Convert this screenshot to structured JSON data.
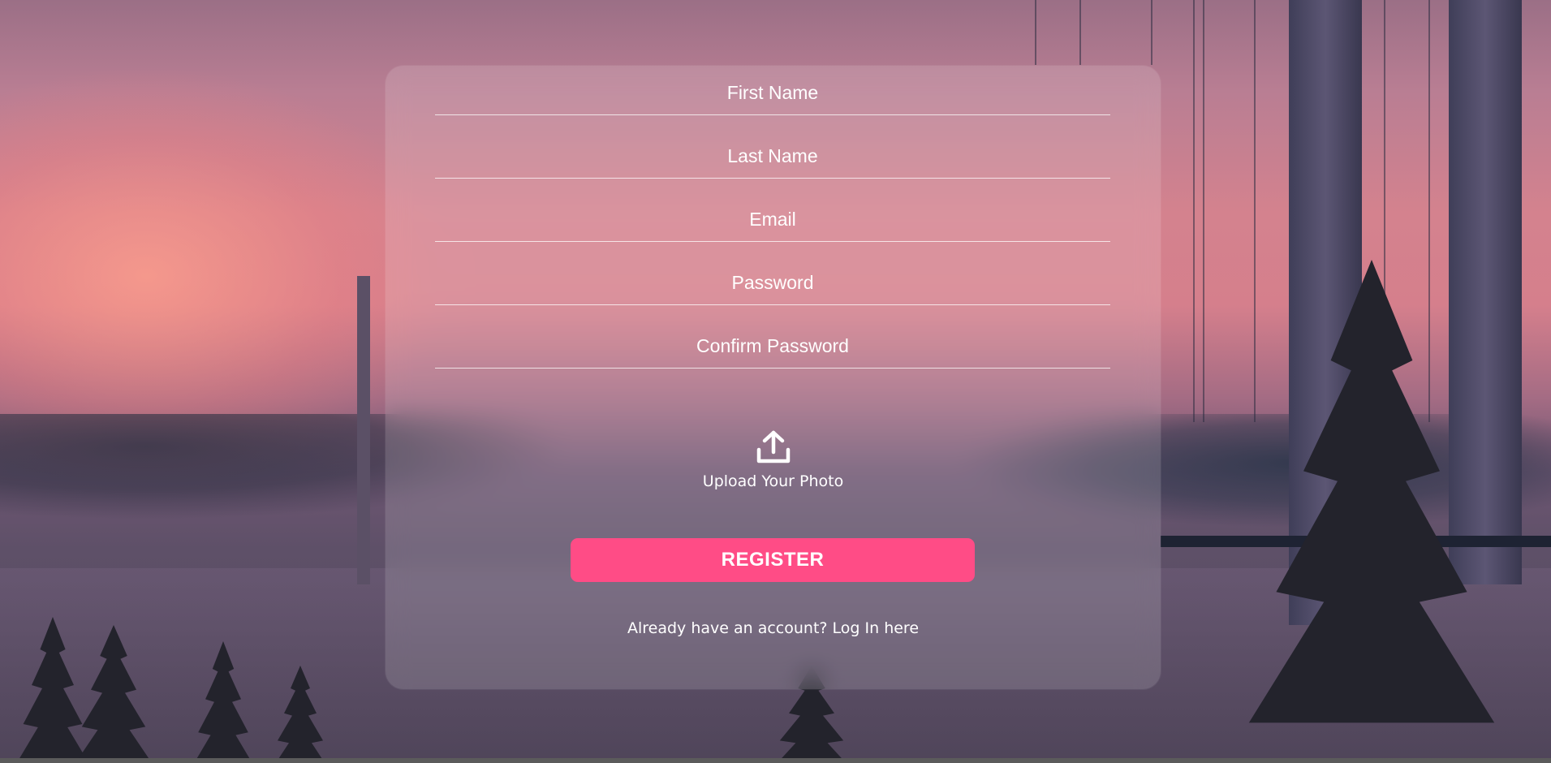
{
  "form": {
    "fields": [
      {
        "placeholder": "First Name"
      },
      {
        "placeholder": "Last Name"
      },
      {
        "placeholder": "Email"
      },
      {
        "placeholder": "Password"
      },
      {
        "placeholder": "Confirm Password"
      }
    ],
    "upload": {
      "icon": "upload-icon",
      "label": "Upload Your Photo"
    },
    "register_label": "REGISTER",
    "login_prompt": "Already have an account? Log In here"
  },
  "colors": {
    "register_button": "#ff4c86",
    "text": "#ffffff"
  }
}
